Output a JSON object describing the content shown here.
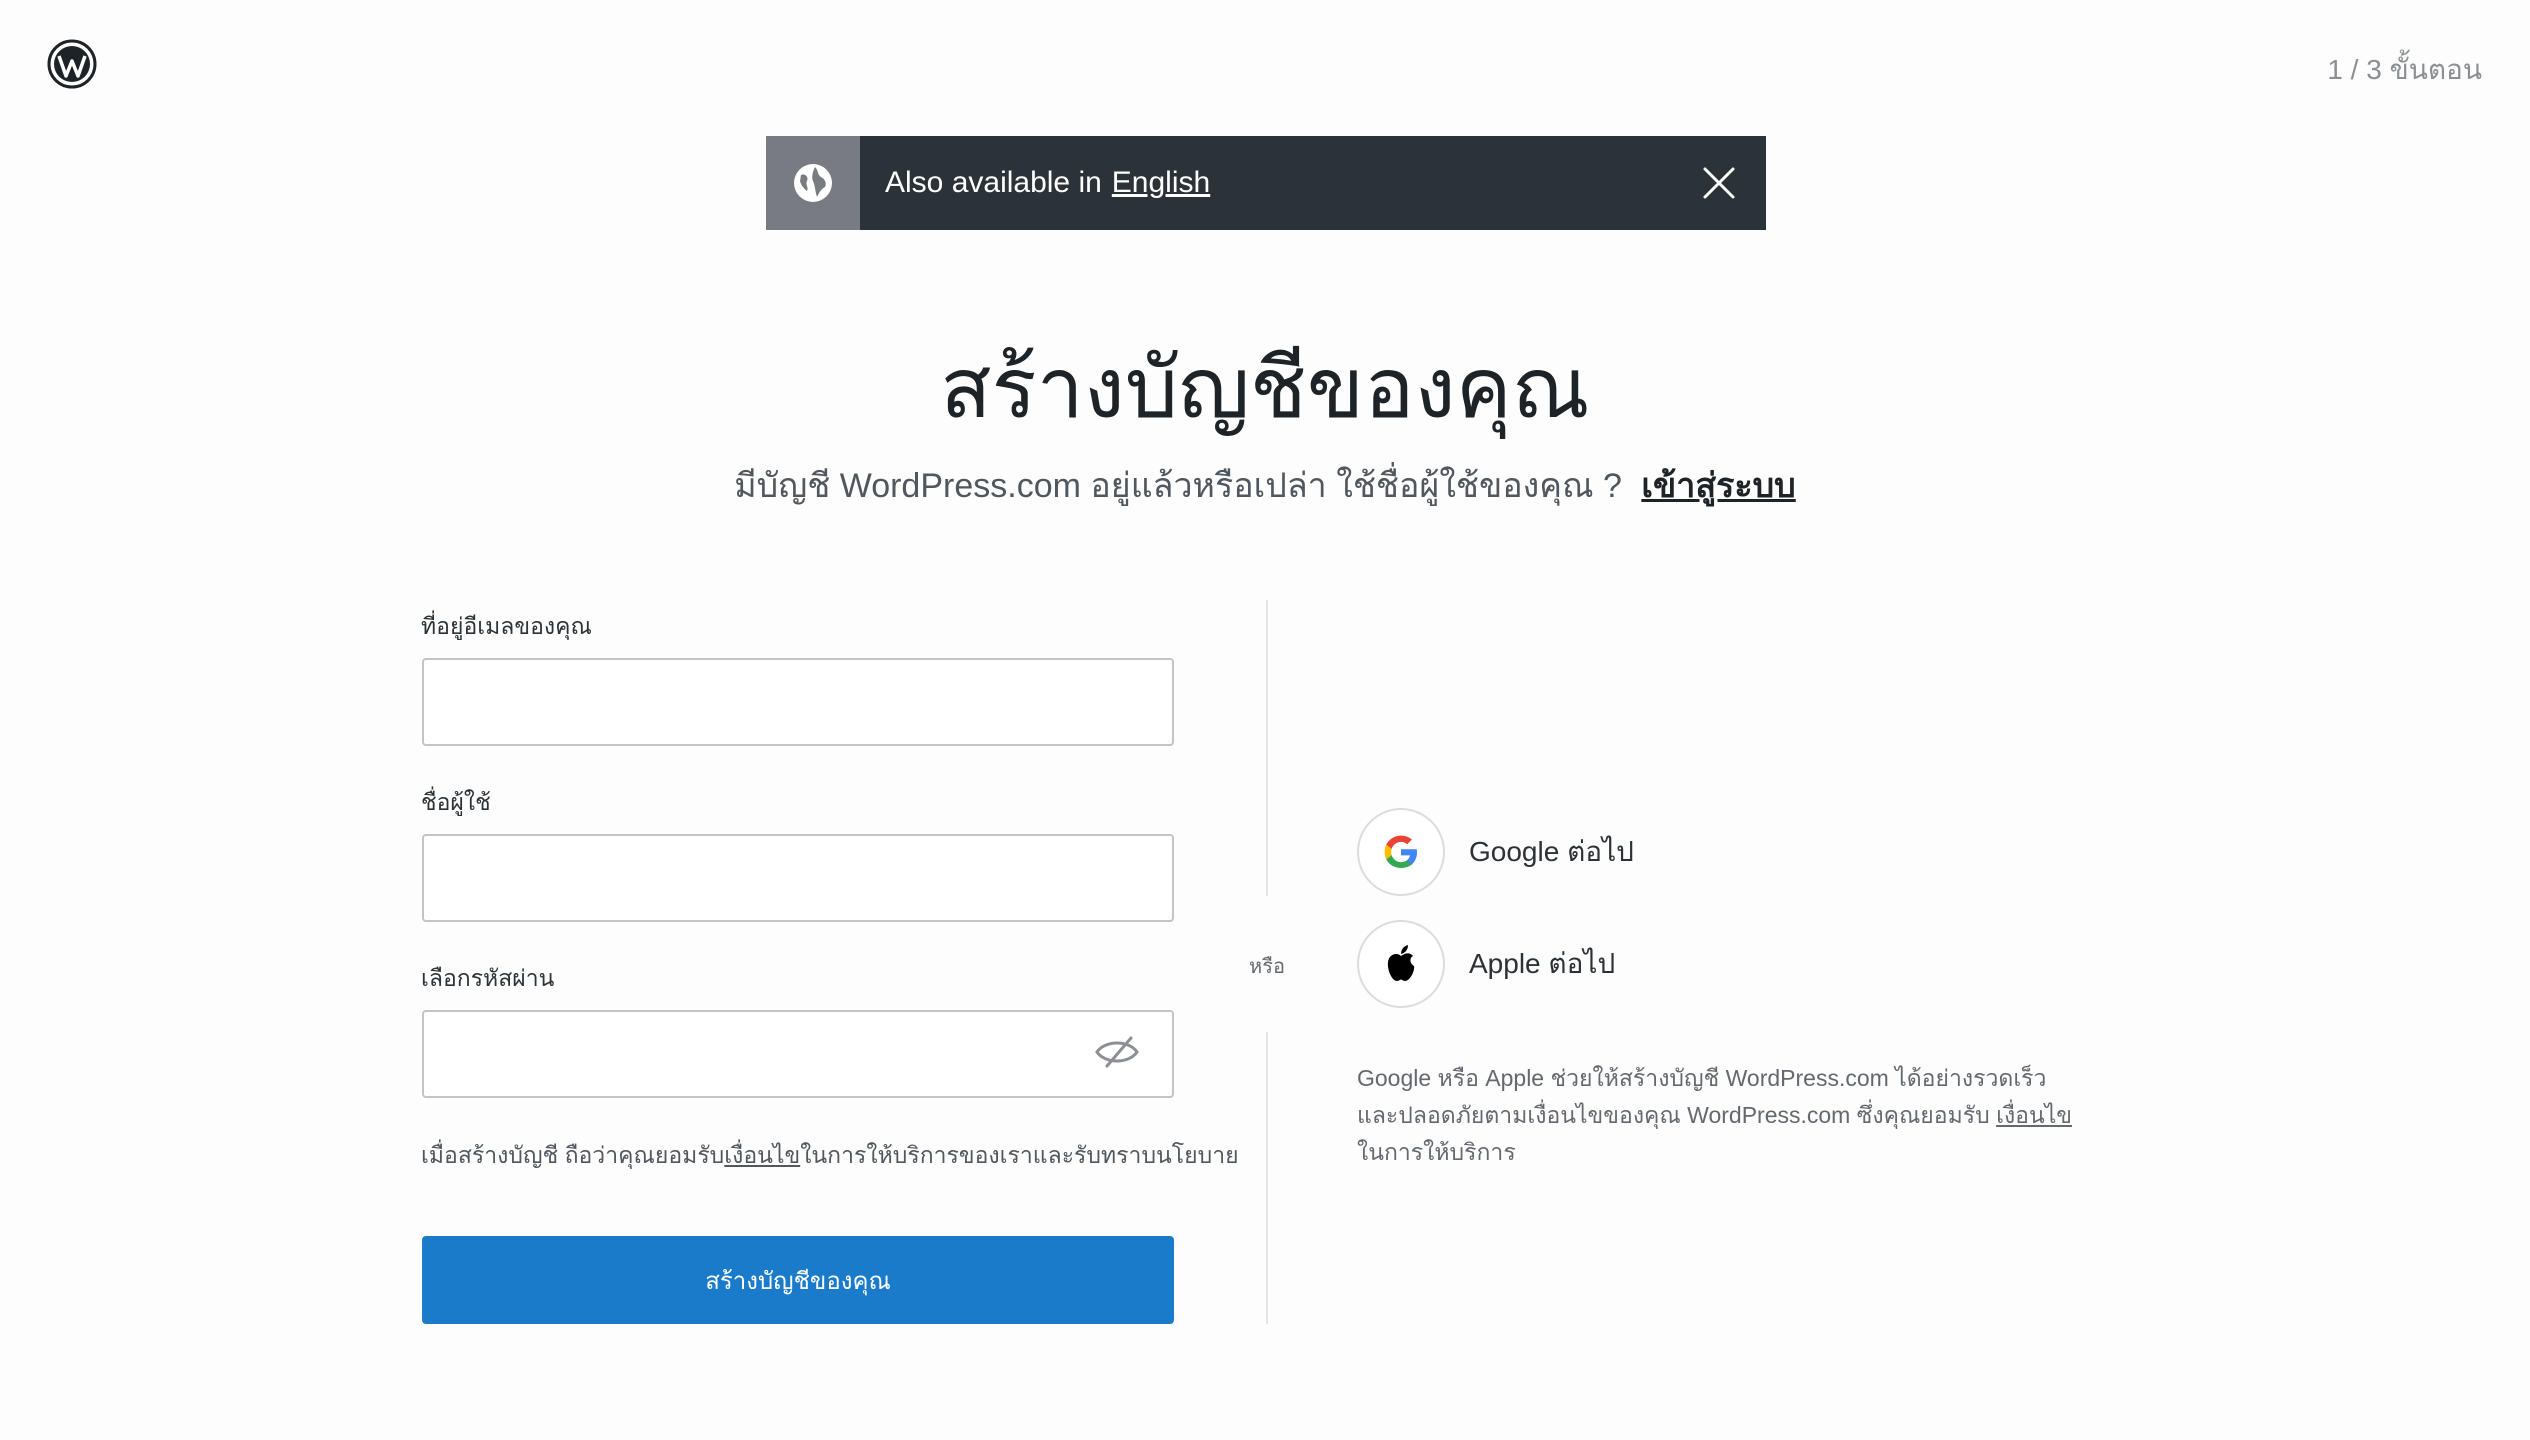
{
  "header": {
    "step_indicator": "1 / 3 ขั้นตอน"
  },
  "banner": {
    "prefix": "Also available in",
    "link": "English"
  },
  "main": {
    "title": "สร้างบัญชีของคุณ",
    "subtitle": "มีบัญชี WordPress.com อยู่แล้วหรือเปล่า ใช้ชื่อผู้ใช้ของคุณ ?",
    "login_link": "เข้าสู่ระบบ"
  },
  "form": {
    "email_label": "ที่อยู่อีเมลของคุณ",
    "username_label": "ชื่อผู้ใช้",
    "password_label": "เลือกรหัสผ่าน",
    "email_value": "",
    "username_value": "",
    "password_value": "",
    "terms_prefix": "เมื่อสร้างบัญชี ถือว่าคุณยอมรับ",
    "terms_link": "เงื่อนไข",
    "terms_suffix": "ในการให้บริการของเราและรับทราบนโยบาย",
    "submit_label": "สร้างบัญชีของคุณ"
  },
  "social": {
    "or_text": "หรือ",
    "google_label": "Google ต่อไป",
    "apple_label": "Apple ต่อไป",
    "disclaimer_text": "Google หรือ Apple ช่วยให้สร้างบัญชี WordPress.com ได้อย่างรวดเร็วและปลอดภัยตามเงื่อนไขของคุณ WordPress.com ซึ่งคุณยอมรับ",
    "disclaimer_link": "เงื่อนไข",
    "disclaimer_suffix": "ในการให้บริการ"
  }
}
